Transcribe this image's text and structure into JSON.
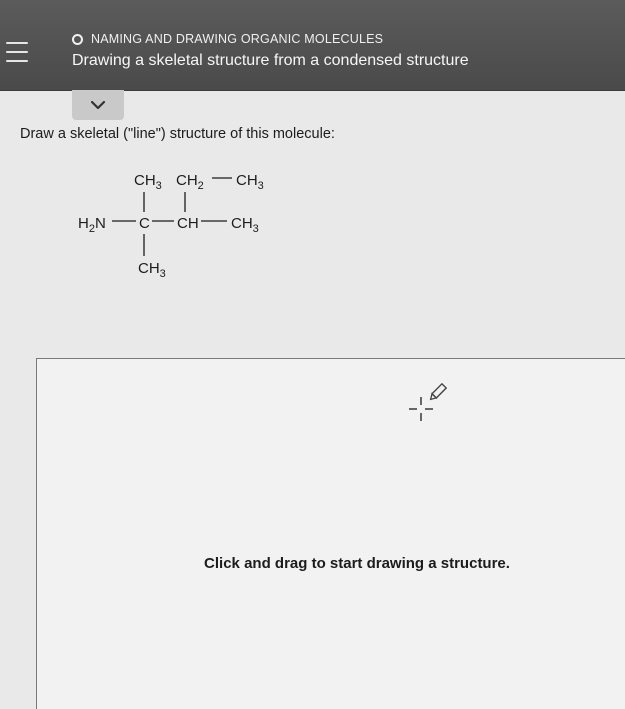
{
  "header": {
    "topic": "NAMING AND DRAWING ORGANIC MOLECULES",
    "title": "Drawing a skeletal structure from a condensed structure",
    "menu_icon": "hamburger-menu-icon",
    "status_icon": "circle-status-icon"
  },
  "collapse_icon": "chevron-down-icon",
  "question": {
    "prompt": "Draw a skeletal (\"line\") structure of this molecule:"
  },
  "molecule": {
    "ch3_top_left": "CH",
    "ch3_top_left_sub": "3",
    "ch2_top": "CH",
    "ch2_top_sub": "2",
    "ch3_top_right": "CH",
    "ch3_top_right_sub": "3",
    "h2n": "H",
    "h2n_sub": "2",
    "h2n_n": "N",
    "c_center": "C",
    "ch_center": "CH",
    "ch3_right": "CH",
    "ch3_right_sub": "3",
    "ch3_bottom": "CH",
    "ch3_bottom_sub": "3"
  },
  "drawing_area": {
    "hint": "Click and drag to start drawing a structure.",
    "cursor_icon": "crosshair-pencil-icon"
  },
  "colors": {
    "header_bg": "#4f4f4f",
    "page_bg": "#e9e9e9",
    "canvas_bg": "#f2f2f2"
  }
}
